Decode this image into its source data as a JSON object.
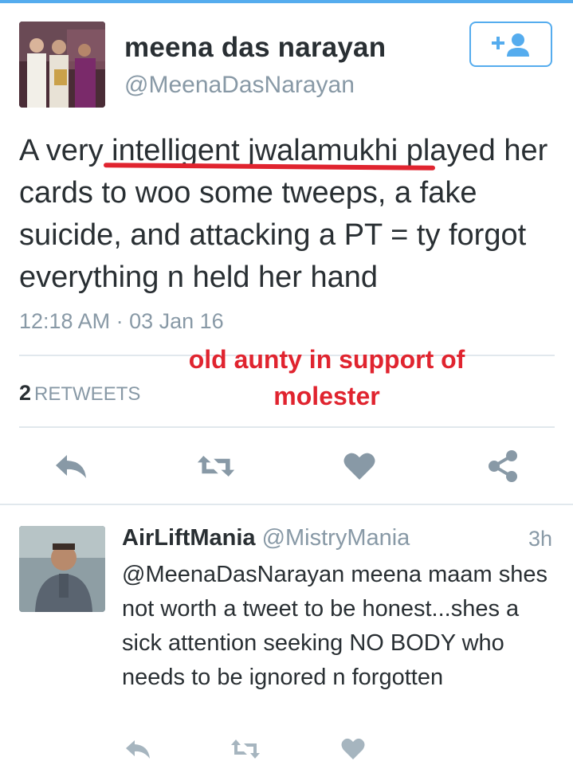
{
  "tweet": {
    "display_name": "meena das narayan",
    "handle": "@MeenaDasNarayan",
    "text": "A very intelligent jwalamukhi played her cards to woo some tweeps, a fake suicide, and attacking a PT = ty forgot everything n held her hand",
    "timestamp": "12:18 AM · 03 Jan 16",
    "retweet_count": "2",
    "retweet_label": "RETWEETS",
    "follow_icon": "add-user-icon"
  },
  "annotation": {
    "text": "old aunty in support of molester",
    "color": "#e0242f"
  },
  "actions": [
    "reply-icon",
    "retweet-icon",
    "like-icon",
    "share-icon"
  ],
  "reply": {
    "display_name": "AirLiftMania",
    "handle": "@MistryMania",
    "time": "3h",
    "text": "@MeenaDasNarayan meena maam shes not worth a tweet to be honest...shes a sick attention seeking NO BODY who needs to be ignored n forgotten"
  },
  "colors": {
    "accent": "#55acee",
    "text": "#292f33",
    "muted": "#8899a6",
    "icon": "#8899a6",
    "divider": "#e1e8ed"
  }
}
